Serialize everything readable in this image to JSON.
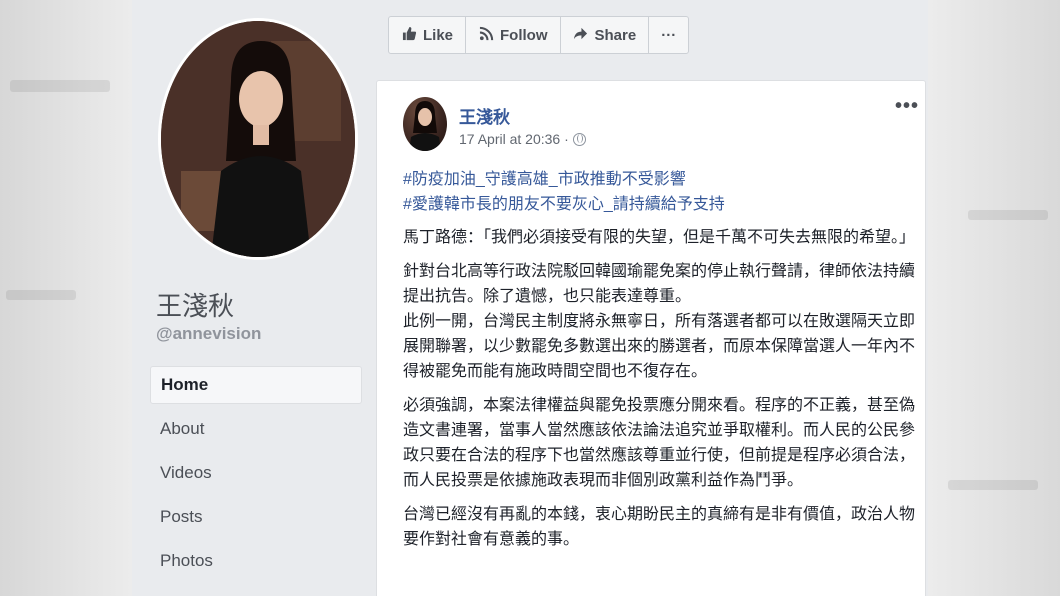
{
  "sidebar": {
    "page_name": "王淺秋",
    "handle": "@annevision",
    "nav": [
      "Home",
      "About",
      "Videos",
      "Posts",
      "Photos"
    ]
  },
  "toolbar": {
    "like": "Like",
    "follow": "Follow",
    "share": "Share",
    "more": "···"
  },
  "post": {
    "author": "王淺秋",
    "timestamp": "17 April at 20:36 ·",
    "more": "•••",
    "hashtags": [
      "#防疫加油_守護高雄_市政推動不受影響",
      "#愛護韓市長的朋友不要灰心_請持續給予支持"
    ],
    "paragraphs": [
      "馬丁路德：「我們必須接受有限的失望，但是千萬不可失去無限的希望。」",
      "針對台北高等行政法院駁回韓國瑜罷免案的停止執行聲請，律師依法持續提出抗告。除了遺憾，也只能表達尊重。\n此例一開，台灣民主制度將永無寧日，所有落選者都可以在敗選隔天立即展開聯署，以少數罷免多數選出來的勝選者，而原本保障當選人一年內不得被罷免而能有施政時間空間也不復存在。",
      "必須強調，本案法律權益與罷免投票應分開來看。程序的不正義，甚至偽造文書連署，當事人當然應該依法論法追究並爭取權利。而人民的公民參政只要在合法的程序下也當然應該尊重並行使，但前提是程序必須合法，而人民投票是依據施政表現而非個別政黨利益作為鬥爭。",
      "台灣已經沒有再亂的本錢，衷心期盼民主的真締有是非有價值，政治人物要作對社會有意義的事。"
    ]
  },
  "colors": {
    "link": "#365899",
    "background": "#e9ebee",
    "text": "#1d2129"
  }
}
